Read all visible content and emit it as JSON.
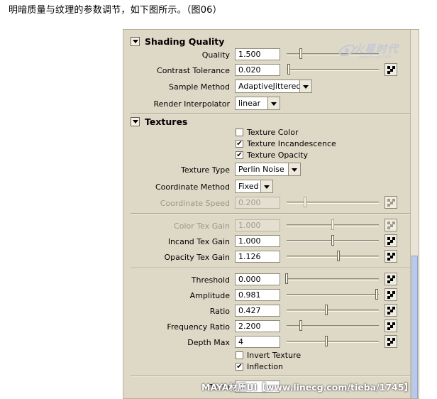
{
  "caption": "明暗质量与纹理的参数调节，如下图所示。（图06）",
  "logo": {
    "text": "火星时代",
    "url": "www.hxsd.com"
  },
  "watermark": "MAYA材质UI【www.linecg.com/tieba/1745】",
  "shading": {
    "title": "Shading Quality",
    "quality": {
      "label": "Quality",
      "value": "1.500",
      "slider": 0.15
    },
    "contrast": {
      "label": "Contrast Tolerance",
      "value": "0.020",
      "slider": 0.02
    },
    "sample_method": {
      "label": "Sample Method",
      "value": "AdaptiveJittered"
    },
    "render_interp": {
      "label": "Render Interpolator",
      "value": "linear"
    }
  },
  "textures": {
    "title": "Textures",
    "texture_color": {
      "label": "Texture Color",
      "checked": false
    },
    "texture_incand": {
      "label": "Texture Incandescence",
      "checked": true
    },
    "texture_opacity": {
      "label": "Texture Opacity",
      "checked": true
    },
    "texture_type": {
      "label": "Texture Type",
      "value": "Perlin Noise"
    },
    "coord_method": {
      "label": "Coordinate Method",
      "value": "Fixed"
    },
    "coord_speed": {
      "label": "Coordinate Speed",
      "value": "0.200",
      "slider": 0.2
    },
    "color_tex_gain": {
      "label": "Color Tex Gain",
      "value": "1.000",
      "slider": 0.5
    },
    "incand_tex_gain": {
      "label": "Incand Tex Gain",
      "value": "1.000",
      "slider": 0.5
    },
    "opacity_tex_gain": {
      "label": "Opacity Tex Gain",
      "value": "1.126",
      "slider": 0.56
    },
    "threshold": {
      "label": "Threshold",
      "value": "0.000",
      "slider": 0.0
    },
    "amplitude": {
      "label": "Amplitude",
      "value": "0.981",
      "slider": 0.98
    },
    "ratio": {
      "label": "Ratio",
      "value": "0.427",
      "slider": 0.43
    },
    "freq_ratio": {
      "label": "Frequency Ratio",
      "value": "2.200",
      "slider": 0.15
    },
    "depth_max": {
      "label": "Depth Max",
      "value": "4",
      "slider": 0.43
    },
    "invert_texture": {
      "label": "Invert Texture",
      "checked": false
    },
    "inflection": {
      "label": "Inflection",
      "checked": true
    },
    "partial_label": "Textu"
  },
  "colors": {
    "panel_bg": "#ded8c6",
    "scroll_thumb": "#b9c9ea"
  }
}
